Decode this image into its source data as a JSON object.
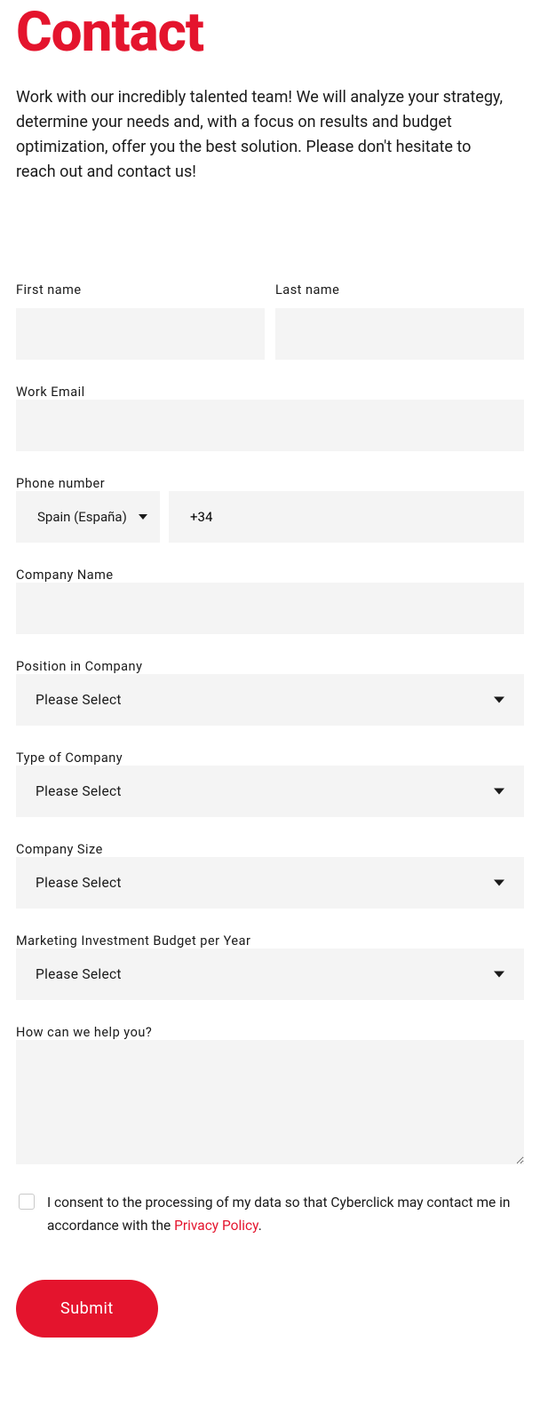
{
  "page": {
    "title": "Contact",
    "intro": "Work with our incredibly talented team! We will analyze your strategy, determine your needs and, with a focus on results and budget optimization, offer you the best solution. Please don't hesitate to reach out and contact us!"
  },
  "form": {
    "first_name_label": "First name",
    "last_name_label": "Last name",
    "email_label": "Work Email",
    "phone_label": "Phone number",
    "phone_country": "Spain (España)",
    "phone_prefix": "+34",
    "company_name_label": "Company Name",
    "position_label": "Position in Company",
    "position_value": "Please Select",
    "type_label": "Type of Company",
    "type_value": "Please Select",
    "size_label": "Company Size",
    "size_value": "Please Select",
    "budget_label": "Marketing Investment Budget per Year",
    "budget_value": "Please Select",
    "help_label": "How can we help you?",
    "consent_prefix": "I consent to the processing of my data so that Cyberclick may contact me in accordance with the ",
    "consent_link": "Privacy Policy",
    "consent_suffix": ".",
    "submit_label": "Submit"
  },
  "colors": {
    "accent": "#e4142d",
    "input_bg": "#f4f4f4"
  }
}
